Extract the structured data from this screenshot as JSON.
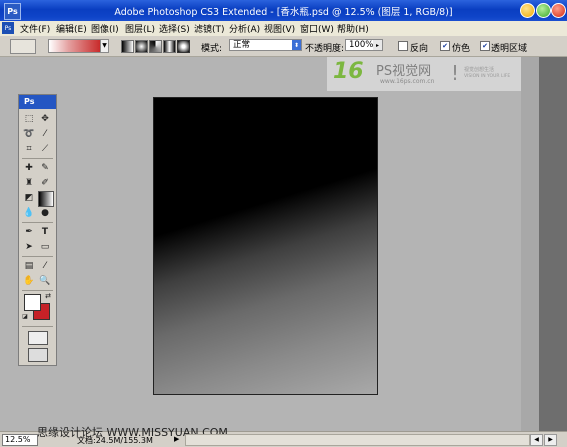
{
  "window": {
    "title": "Adobe Photoshop CS3 Extended - [香水瓶.psd @ 12.5% (图层 1, RGB/8)]",
    "logo_text": "Ps"
  },
  "menu": {
    "items": [
      "文件(F)",
      "编辑(E)",
      "图像(I)",
      "图层(L)",
      "选择(S)",
      "滤镜(T)",
      "分析(A)",
      "视图(V)",
      "窗口(W)",
      "帮助(H)"
    ]
  },
  "options": {
    "mode_label": "模式:",
    "mode_value": "正常",
    "opacity_label": "不透明度:",
    "opacity_value": "100%",
    "reverse_label": "反向",
    "reverse_checked": false,
    "dither_label": "仿色",
    "dither_checked": true,
    "transparency_label": "透明区域",
    "transparency_checked": true,
    "gradient_colors": [
      "#ffffff",
      "#c41818"
    ]
  },
  "watermark": {
    "brand_number": "16",
    "brand_name": "PS视觉网",
    "url": "www.16ps.com.cn",
    "slogan_cn": "视觉创想生活",
    "slogan_en": "VISION IN YOUR LIFE"
  },
  "toolbox": {
    "header": "Ps",
    "foreground_color": "#ffffff",
    "background_color": "#c62127"
  },
  "status": {
    "zoom": "12.5%",
    "site": "思缘设计论坛 WWW.MISSYUAN.COM",
    "doc_info": "文档:24.5M/155.3M"
  }
}
